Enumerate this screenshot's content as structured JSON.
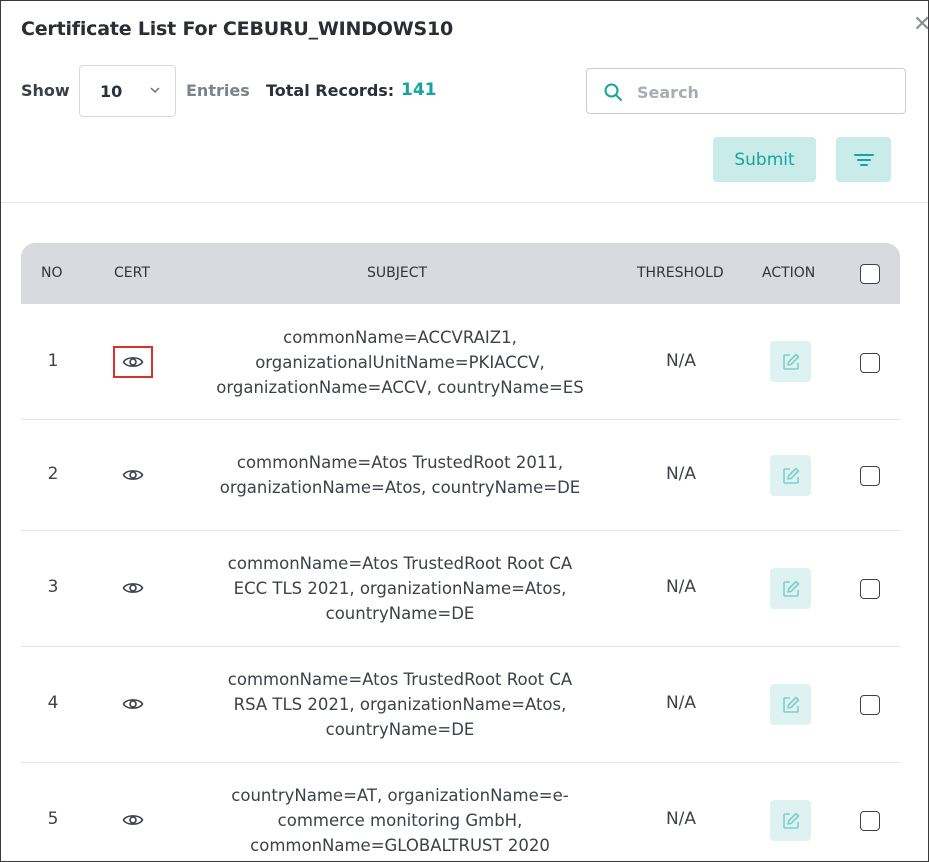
{
  "modal": {
    "title": "Certificate List For CEBURU_WINDOWS10",
    "close_icon": "close-icon"
  },
  "controls": {
    "show_label": "Show",
    "entries_value": "10",
    "entries_label": "Entries",
    "total_label": "Total Records:",
    "total_value": "141",
    "search_placeholder": "Search",
    "submit_label": "Submit"
  },
  "colors": {
    "accent": "#17a3a0",
    "button_bg": "#c9ecea",
    "header_bg": "#d8dadf",
    "highlight": "#d9312b"
  },
  "table": {
    "headers": {
      "no": "NO",
      "cert": "CERT",
      "subject": "SUBJECT",
      "threshold": "THRESHOLD",
      "action": "ACTION"
    },
    "rows": [
      {
        "no": "1",
        "subject_lines": [
          "commonName=ACCVRAIZ1,",
          "organizationalUnitName=PKIACCV,",
          "organizationName=ACCV, countryName=ES"
        ],
        "threshold": "N/A",
        "selected_view": true
      },
      {
        "no": "2",
        "subject_lines": [
          "commonName=Atos TrustedRoot 2011,",
          "organizationName=Atos, countryName=DE"
        ],
        "threshold": "N/A"
      },
      {
        "no": "3",
        "subject_lines": [
          "commonName=Atos TrustedRoot Root CA",
          "ECC TLS 2021, organizationName=Atos,",
          "countryName=DE"
        ],
        "threshold": "N/A"
      },
      {
        "no": "4",
        "subject_lines": [
          "commonName=Atos TrustedRoot Root CA",
          "RSA TLS 2021, organizationName=Atos,",
          "countryName=DE"
        ],
        "threshold": "N/A"
      },
      {
        "no": "5",
        "subject_lines": [
          "countryName=AT, organizationName=e-",
          "commerce monitoring GmbH,",
          "commonName=GLOBALTRUST 2020"
        ],
        "threshold": "N/A"
      }
    ]
  }
}
